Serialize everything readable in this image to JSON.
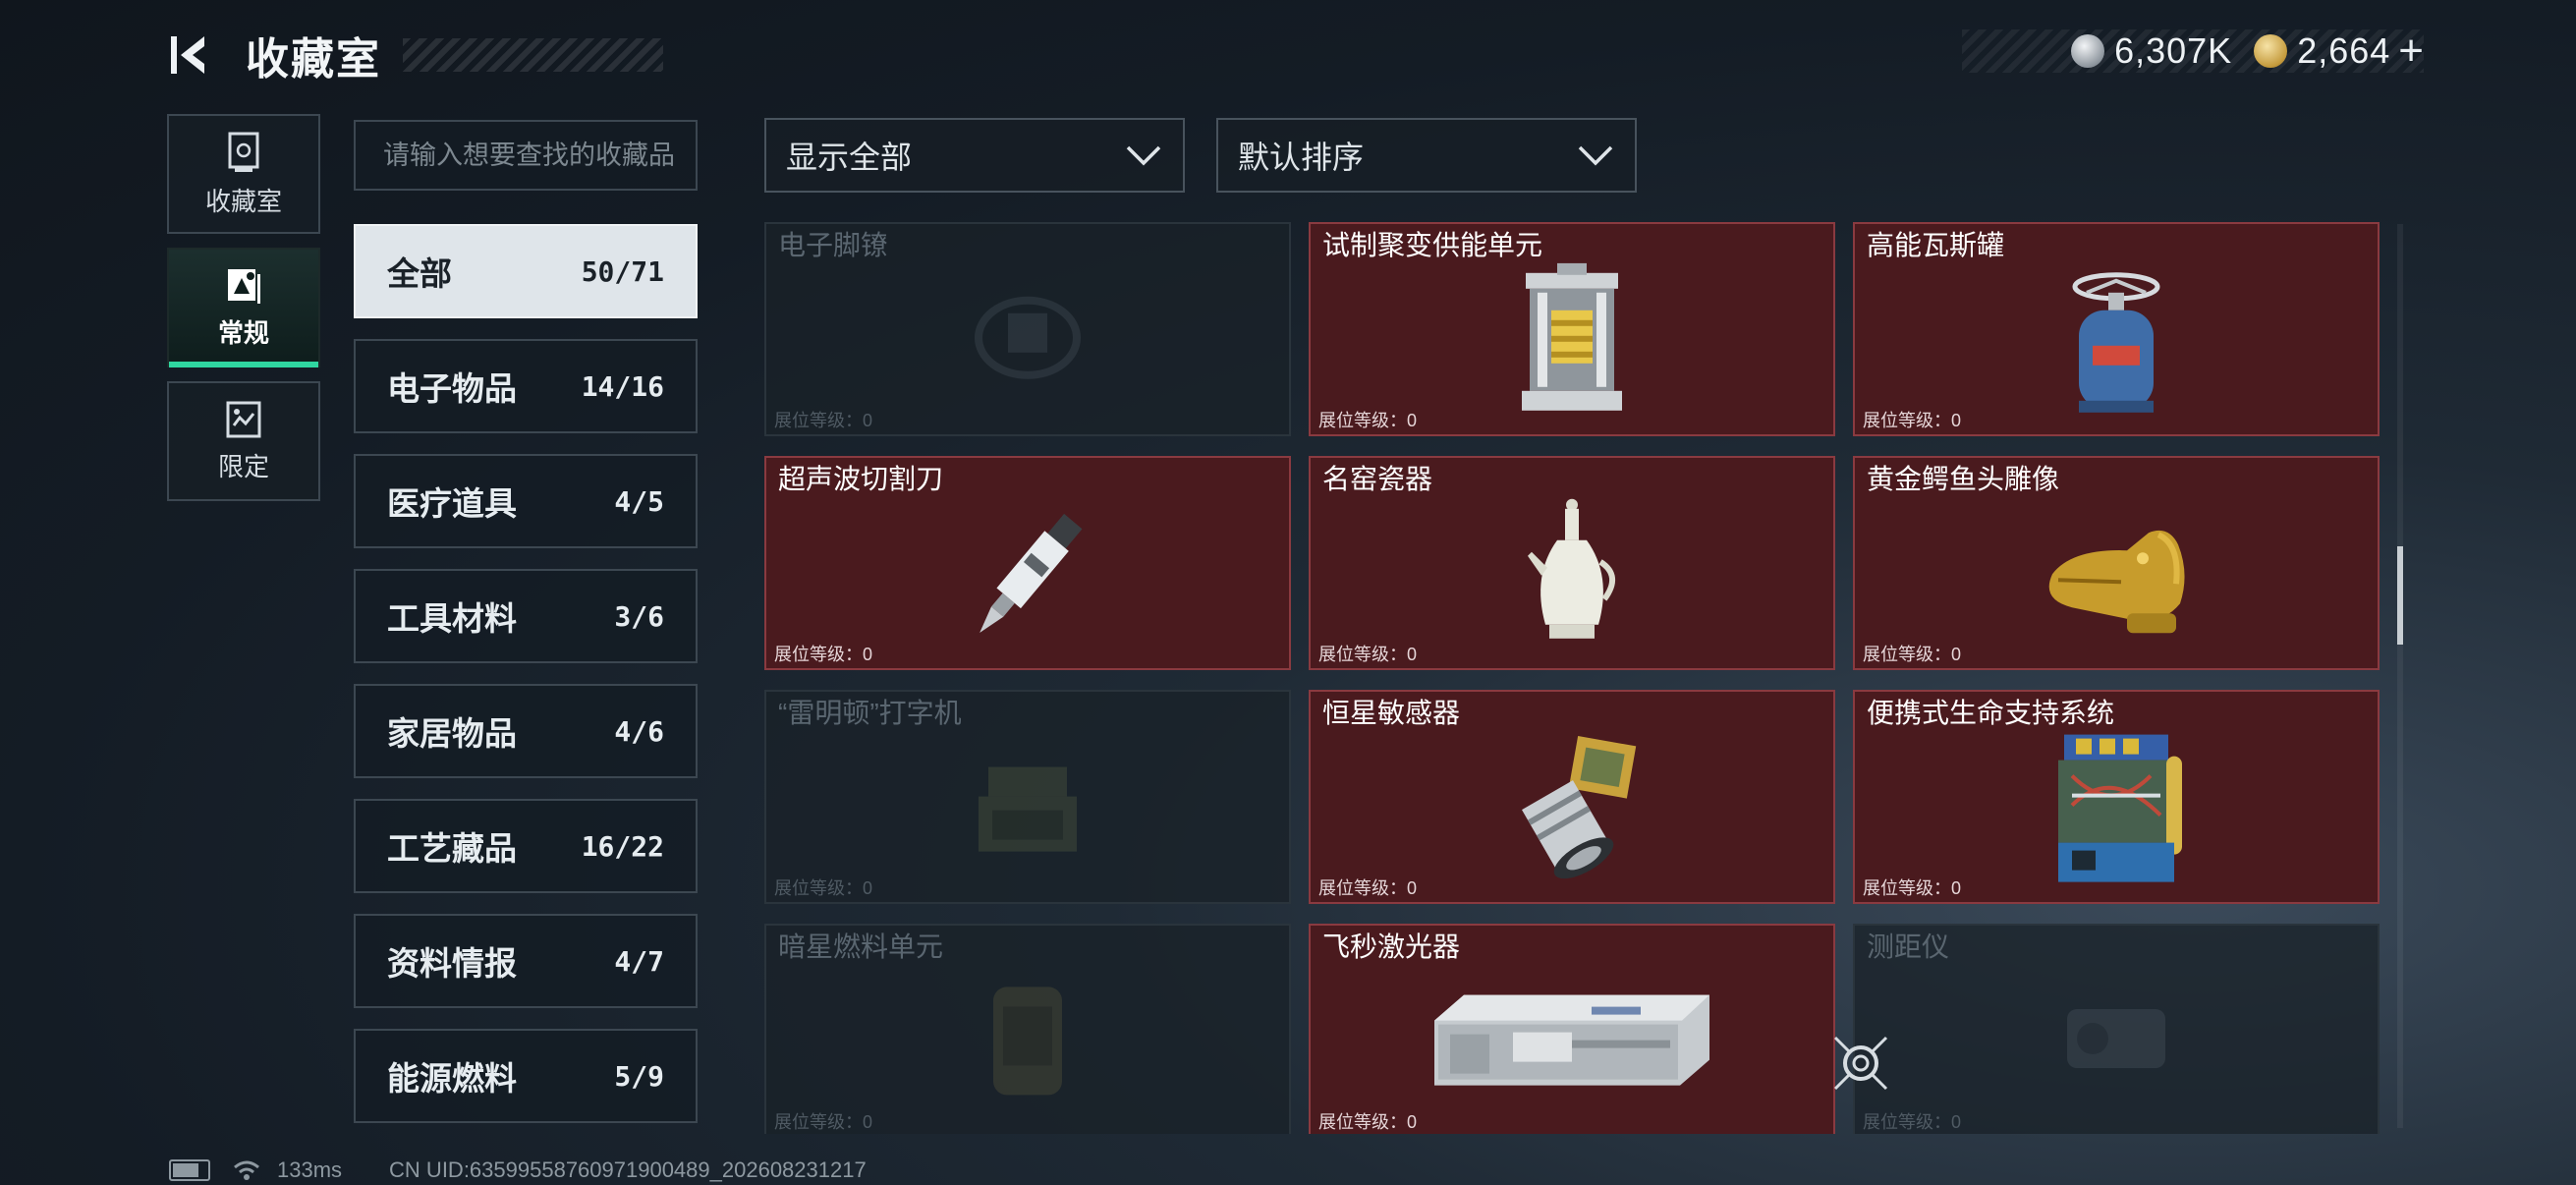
{
  "header": {
    "title": "收藏室",
    "currency": [
      {
        "icon": "silver-coin-icon",
        "value": "6,307K"
      },
      {
        "icon": "gold-coin-icon",
        "value": "2,664"
      }
    ],
    "add_label": "+"
  },
  "sidenav": [
    {
      "label": "收藏室",
      "icon": "collection-room-icon",
      "active": false
    },
    {
      "label": "常规",
      "icon": "regular-icon",
      "active": true
    },
    {
      "label": "限定",
      "icon": "limited-icon",
      "active": false
    }
  ],
  "search": {
    "placeholder": "请输入想要查找的收藏品",
    "value": ""
  },
  "filters": {
    "display": {
      "value": "显示全部"
    },
    "sort": {
      "value": "默认排序"
    }
  },
  "categories": [
    {
      "name": "全部",
      "count": "50/71",
      "active": true
    },
    {
      "name": "电子物品",
      "count": "14/16"
    },
    {
      "name": "医疗道具",
      "count": "4/5"
    },
    {
      "name": "工具材料",
      "count": "3/6"
    },
    {
      "name": "家居物品",
      "count": "4/6"
    },
    {
      "name": "工艺藏品",
      "count": "16/22"
    },
    {
      "name": "资料情报",
      "count": "4/7"
    },
    {
      "name": "能源燃料",
      "count": "5/9"
    }
  ],
  "items": [
    {
      "name": "电子脚镣",
      "level": "展位等级：0",
      "owned": false,
      "icon": "ankle-monitor-icon"
    },
    {
      "name": "试制聚变供能单元",
      "level": "展位等级：0",
      "owned": true,
      "icon": "fusion-cell-icon"
    },
    {
      "name": "高能瓦斯罐",
      "level": "展位等级：0",
      "owned": true,
      "icon": "gas-canister-icon"
    },
    {
      "name": "超声波切割刀",
      "level": "展位等级：0",
      "owned": true,
      "icon": "ultrasonic-knife-icon"
    },
    {
      "name": "名窑瓷器",
      "level": "展位等级：0",
      "owned": true,
      "icon": "porcelain-vase-icon"
    },
    {
      "name": "黄金鳄鱼头雕像",
      "level": "展位等级：0",
      "owned": true,
      "icon": "gold-crocodile-icon"
    },
    {
      "name": "“雷明顿”打字机",
      "level": "展位等级：0",
      "owned": false,
      "icon": "typewriter-icon"
    },
    {
      "name": "恒星敏感器",
      "level": "展位等级：0",
      "owned": true,
      "icon": "star-sensor-icon"
    },
    {
      "name": "便携式生命支持系统",
      "level": "展位等级：0",
      "owned": true,
      "icon": "life-support-icon"
    },
    {
      "name": "暗星燃料单元",
      "level": "展位等级：0",
      "owned": false,
      "icon": "fuel-cell-icon"
    },
    {
      "name": "飞秒激光器",
      "level": "展位等级：0",
      "owned": true,
      "icon": "femto-laser-icon"
    },
    {
      "name": "测距仪",
      "level": "展位等级：0",
      "owned": false,
      "icon": "rangefinder-icon"
    }
  ],
  "scroll_position": 0.4,
  "status_bar": {
    "ping": "133ms",
    "uid": "CN UID:6359955876097190048​9_202608231217"
  },
  "colors": {
    "accent": "#2fd6a0",
    "owned_card": "#4a1a1e",
    "owned_border": "#8a3a40"
  }
}
